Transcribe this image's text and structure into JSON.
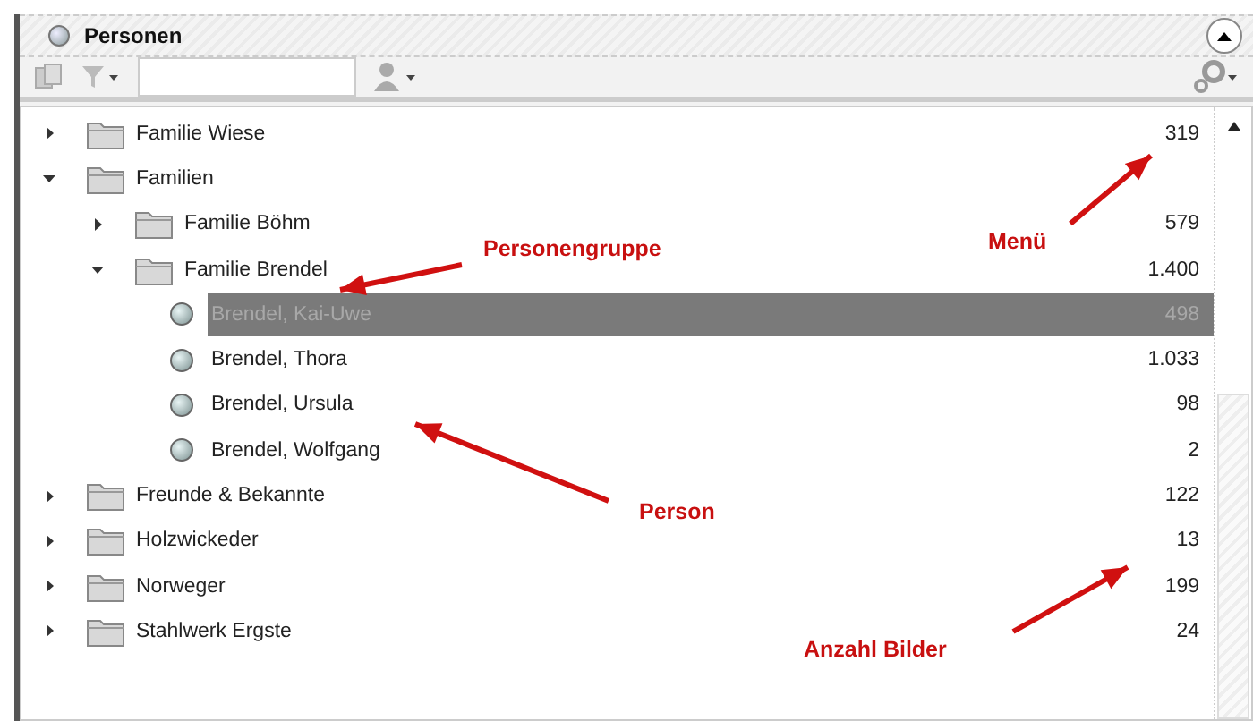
{
  "panel": {
    "title": "Personen"
  },
  "tree": [
    {
      "kind": "folder",
      "label": "Familie Wiese",
      "count": "319",
      "expanded": false,
      "selected": false
    },
    {
      "kind": "folder",
      "label": "Familien",
      "expanded": true,
      "selected": false,
      "children": [
        {
          "kind": "folder",
          "label": "Familie Böhm",
          "count": "579",
          "expanded": false,
          "selected": false
        },
        {
          "kind": "folder",
          "label": "Familie Brendel",
          "count": "1.400",
          "expanded": true,
          "selected": false,
          "children": [
            {
              "kind": "person",
              "label": "Brendel, Kai-Uwe",
              "count": "498",
              "selected": true
            },
            {
              "kind": "person",
              "label": "Brendel, Thora",
              "count": "1.033",
              "selected": false
            },
            {
              "kind": "person",
              "label": "Brendel, Ursula",
              "count": "98",
              "selected": false
            },
            {
              "kind": "person",
              "label": "Brendel, Wolfgang",
              "count": "2",
              "selected": false
            }
          ]
        }
      ]
    },
    {
      "kind": "folder",
      "label": "Freunde & Bekannte",
      "count": "122",
      "expanded": false,
      "selected": false
    },
    {
      "kind": "folder",
      "label": "Holzwickeder",
      "count": "13",
      "expanded": false,
      "selected": false
    },
    {
      "kind": "folder",
      "label": "Norweger",
      "count": "199",
      "expanded": false,
      "selected": false
    },
    {
      "kind": "folder",
      "label": "Stahlwerk Ergste",
      "count": "24",
      "expanded": false,
      "selected": false
    }
  ],
  "annotations": [
    {
      "text": "Personengruppe"
    },
    {
      "text": "Menü"
    },
    {
      "text": "Person"
    },
    {
      "text": "Anzahl Bilder"
    }
  ]
}
